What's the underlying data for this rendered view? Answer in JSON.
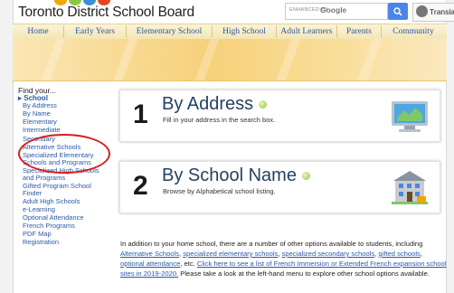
{
  "header": {
    "brand": "Toronto District School Board",
    "search_enhanced": "ENHANCED BY",
    "search_google": "Google",
    "translate_label": "Translate"
  },
  "nav": {
    "items": [
      "Home",
      "Early Years",
      "Elementary School",
      "High School",
      "Adult Learners",
      "Parents",
      "Community"
    ]
  },
  "sidebar": {
    "find_label": "Find your...",
    "section": "School",
    "items": [
      "By Address",
      "By Name",
      "Elementary",
      "Intermediate",
      "Secondary",
      "Alternative Schools",
      "Specialized Elementary Schools and Programs",
      "Specialized High Schools and Programs",
      "Gifted Program School Finder",
      "Adult High Schools",
      "e-Learning",
      "Optional Attendance",
      "French Programs",
      "PDF Map",
      "Registration"
    ]
  },
  "cards": [
    {
      "num": "1",
      "title": "By Address",
      "sub": "Fill in your address in the search box.",
      "icon": "map-monitor-icon"
    },
    {
      "num": "2",
      "title": "By School Name",
      "sub": "Browse by Alphabetical school listing.",
      "icon": "school-building-icon"
    }
  ],
  "paragraph": {
    "intro": "In addition to your home school, there are a number of other options available to students, including",
    "link1": "Alternative Schools",
    "link2": "specialized elementary schools",
    "link3": "specialized secondary schools",
    "link4": "gifted schools",
    "link5": "optional attendance",
    "mid": ", etc.",
    "link6": "Click here to see a list of French Immersion or Extended French expansion school sites in 2019-2020.",
    "tail": "Please take a look at the left-hand menu to explore other school options available."
  },
  "colors": {
    "link": "#2a5aa8",
    "highlight_circle": "#d81e1e",
    "nav_bg": "#f3e6b8"
  }
}
